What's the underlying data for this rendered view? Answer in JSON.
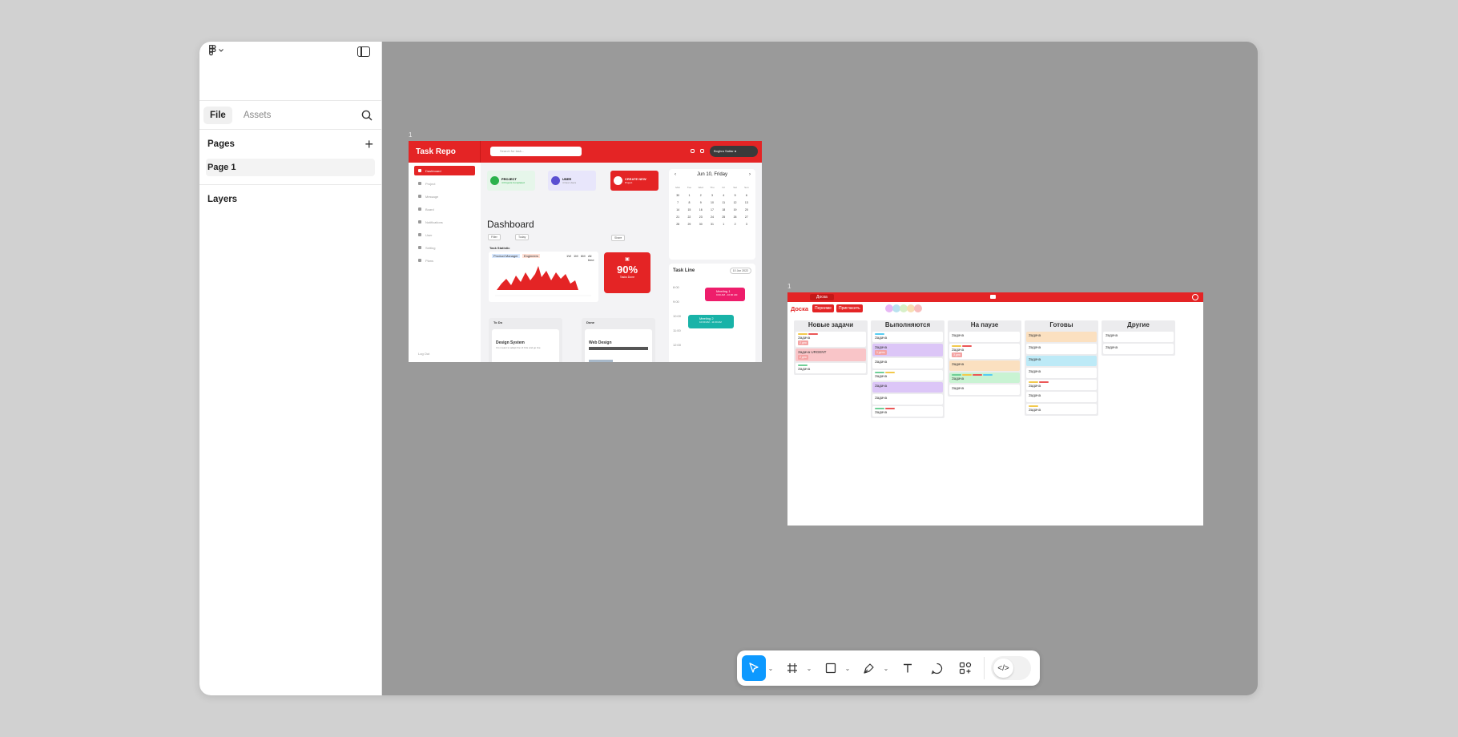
{
  "sidebar": {
    "tabs": [
      {
        "label": "File"
      },
      {
        "label": "Assets"
      }
    ],
    "pages_heading": "Pages",
    "add_page_glyph": "+",
    "pages": [
      {
        "label": "Page 1"
      }
    ],
    "layers_heading": "Layers"
  },
  "canvas": {
    "frames": [
      {
        "label": "1",
        "app": {
          "brand": "Task Repo",
          "search_placeholder": "Search for task...",
          "user_label": "Boghra Sattar ●",
          "nav": [
            "Dashboard",
            "Project",
            "Message",
            "Board",
            "Notifications",
            "User",
            "Setting",
            "Plans"
          ],
          "logout": "Log Out",
          "stat_cards": [
            {
              "title": "PROJECT",
              "sub": "4 Projects Completed",
              "color": "#e6f6ea",
              "dot": "#2bb24c"
            },
            {
              "title": "USER",
              "sub": "4 New Users",
              "color": "#e8e6fb",
              "dot": "#5a4fd1"
            },
            {
              "title": "CREATE NEW",
              "sub": "Project",
              "color": "#e42425",
              "dot": "#ffffff"
            }
          ],
          "page_title": "Dashboard",
          "filters": [
            "Filter",
            "Today"
          ],
          "share": "Share",
          "section": "Task Statistic",
          "legend": [
            "Product Manager",
            "Engineers"
          ],
          "periods": [
            "1W",
            "1M",
            "6M",
            "All time"
          ],
          "percent": "90%",
          "percent_label": "Tasks Done",
          "columns": [
            {
              "title": "To Do",
              "card_title": "Design System",
              "card_text": "It is meant to adapt the UI Kits and go live"
            },
            {
              "title": "Done",
              "card_title": "Web Design"
            }
          ],
          "calendar": {
            "month": "Jun 10, Friday",
            "weekdays": [
              "Mon",
              "Tue",
              "Wed",
              "Thu",
              "Fri",
              "Sat",
              "Sun"
            ],
            "days": [
              "30",
              "1",
              "2",
              "3",
              "4",
              "5",
              "6",
              "7",
              "8",
              "9",
              "10",
              "11",
              "12",
              "13",
              "14",
              "15",
              "16",
              "17",
              "18",
              "19",
              "20",
              "21",
              "22",
              "23",
              "24",
              "25",
              "26",
              "27",
              "28",
              "29",
              "30",
              "31",
              "1",
              "2",
              "3"
            ]
          },
          "timeline": {
            "title": "Task Line",
            "date": "10 Jun 2022",
            "times": [
              "8:00",
              "9:00",
              "10:00",
              "11:00",
              "12:00"
            ],
            "events": [
              {
                "title": "Meeting 1",
                "time": "9:00 AM - 10:00 AM",
                "color": "#ee1d6b"
              },
              {
                "title": "Meeting 2",
                "time": "10:00 AM - 11:00 AM",
                "color": "#19b3a8"
              }
            ]
          }
        }
      },
      {
        "label": "1",
        "app": {
          "tab": "Доска",
          "title": "Доска",
          "buttons": [
            "Переиме",
            "Пригласить"
          ],
          "avatar_colors": [
            "#e7b8f5",
            "#b9e2ef",
            "#d7f0c8",
            "#f8dfb3",
            "#f8bdbd"
          ],
          "columns": [
            {
              "title": "Новые задачи",
              "cards": [
                {
                  "text": "Задача",
                  "tags": [
                    "#f2c94c",
                    "#eb5757"
                  ],
                  "bg": "#ffffff",
                  "badge": "2 дня"
                },
                {
                  "text": "Задача URGENT",
                  "tags": [],
                  "bg": "#f9c5c8",
                  "badge": "2 дня"
                },
                {
                  "text": "Задача",
                  "tags": [
                    "#6fcf97"
                  ],
                  "bg": "#ffffff"
                }
              ]
            },
            {
              "title": "Выполняются",
              "cards": [
                {
                  "text": "Задача",
                  "tags": [
                    "#56ccf2"
                  ],
                  "bg": "#ffffff"
                },
                {
                  "text": "Задача",
                  "tags": [],
                  "bg": "#dcc6f7",
                  "badge": "1 день"
                },
                {
                  "text": "Задача",
                  "tags": [],
                  "bg": "#ffffff"
                },
                {
                  "text": "Задача",
                  "tags": [
                    "#6fcf97",
                    "#f2c94c"
                  ],
                  "bg": "#ffffff"
                },
                {
                  "text": "Задача",
                  "tags": [],
                  "bg": "#dcc6f7"
                },
                {
                  "text": "Задача",
                  "tags": [],
                  "bg": "#ffffff"
                },
                {
                  "text": "Задача",
                  "tags": [
                    "#6fcf97",
                    "#eb5757"
                  ],
                  "bg": "#ffffff"
                }
              ]
            },
            {
              "title": "На паузе",
              "cards": [
                {
                  "text": "Задача",
                  "tags": [],
                  "bg": "#ffffff"
                },
                {
                  "text": "Задача",
                  "tags": [
                    "#f2c94c",
                    "#eb5757"
                  ],
                  "bg": "#ffffff",
                  "badge": "3 дня"
                },
                {
                  "text": "Задача",
                  "tags": [],
                  "bg": "#fbe0c0"
                },
                {
                  "text": "Задача",
                  "tags": [
                    "#6fcf97",
                    "#f2c94c",
                    "#eb5757",
                    "#56ccf2"
                  ],
                  "bg": "#c9f3d3"
                },
                {
                  "text": "Задача",
                  "tags": [],
                  "bg": "#ffffff"
                }
              ]
            },
            {
              "title": "Готовы",
              "cards": [
                {
                  "text": "Задача",
                  "tags": [],
                  "bg": "#fbe0c0"
                },
                {
                  "text": "Задача",
                  "tags": [],
                  "bg": "#ffffff"
                },
                {
                  "text": "Задача",
                  "tags": [],
                  "bg": "#bdeaf7"
                },
                {
                  "text": "Задача",
                  "tags": [],
                  "bg": "#ffffff"
                },
                {
                  "text": "Задача",
                  "tags": [
                    "#f2c94c",
                    "#eb5757"
                  ],
                  "bg": "#ffffff"
                },
                {
                  "text": "Задача",
                  "tags": [],
                  "bg": "#ffffff"
                },
                {
                  "text": "Задача",
                  "tags": [
                    "#f2c94c"
                  ],
                  "bg": "#ffffff"
                }
              ]
            },
            {
              "title": "Другие",
              "cards": [
                {
                  "text": "Задача",
                  "tags": [],
                  "bg": "#ffffff"
                },
                {
                  "text": "Задача",
                  "tags": [],
                  "bg": "#ffffff"
                }
              ]
            }
          ]
        }
      }
    ]
  },
  "toolbar": {
    "tools": [
      {
        "name": "move-tool",
        "icon": "cursor-icon",
        "selected": true,
        "caret": true
      },
      {
        "name": "frame-tool",
        "icon": "frame-icon",
        "caret": true
      },
      {
        "name": "shape-tool",
        "icon": "rectangle-icon",
        "caret": true
      },
      {
        "name": "pen-tool",
        "icon": "pen-icon",
        "caret": true
      },
      {
        "name": "text-tool",
        "icon": "text-icon",
        "caret": false
      },
      {
        "name": "comment-tool",
        "icon": "comment-icon",
        "caret": false
      },
      {
        "name": "actions-tool",
        "icon": "components-icon",
        "caret": false
      }
    ],
    "dev_mode_glyph": "</>"
  },
  "colors": {
    "accent": "#0d99ff",
    "brand_red": "#e42425",
    "canvas": "#9a9a9a"
  }
}
